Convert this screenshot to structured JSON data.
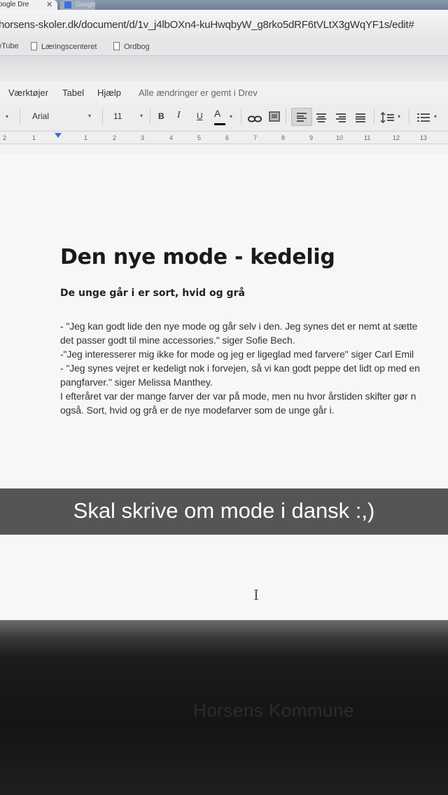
{
  "browser": {
    "active_tab_title": "oogle Dre",
    "close_glyph": "✕",
    "second_tab_title": "Google",
    "url": "horsens-skoler.dk/document/d/1v_j4lbOXn4-kuHwqbyW_g8rko5dRF6tVLtX3gWqYF1s/edit#",
    "bookmarks": [
      {
        "label": "eTube"
      },
      {
        "label": "Læringscenteret",
        "icon": "page-icon"
      },
      {
        "label": "Ordbog",
        "icon": "page-icon"
      }
    ]
  },
  "menubar": {
    "items": [
      "Værktøjer",
      "Tabel",
      "Hjælp"
    ],
    "save_status": "Alle ændringer er gemt i Drev"
  },
  "toolbar": {
    "font_name": "Arial",
    "font_size": "11",
    "bold": "B",
    "italic": "I",
    "underline": "U",
    "text_color": "A",
    "dropdown_glyph": "▾",
    "text_color_value": "#000000"
  },
  "ruler": {
    "ticks": [
      "2",
      "1",
      "1",
      "2",
      "3",
      "4",
      "5",
      "6",
      "7",
      "8",
      "9",
      "10",
      "11",
      "12",
      "13"
    ]
  },
  "document": {
    "title": "Den nye mode - kedelig",
    "subtitle": "De unge går i er sort, hvid og grå",
    "lines": [
      "- \"Jeg kan godt lide den nye mode og går selv i den. Jeg synes det er nemt at sætte",
      "det passer godt til mine accessories.\" siger Sofie Bech.",
      "-\"Jeg interesserer mig ikke for mode og jeg er ligeglad med farvere\" siger Carl Emil",
      "- \"Jeg synes vejret er kedeligt nok i forvejen, så vi kan godt peppe det lidt op med en",
      "pangfarver.\" siger Melissa Manthey.",
      "I efteråret var der mange farver der var på mode, men nu hvor årstiden skifter gør n",
      "også. Sort, hvid og grå er de nye modefarver som de unge går i."
    ]
  },
  "caption": {
    "text": "Skal skrive om mode i dansk :,)"
  },
  "monitor": {
    "brand_label": "Horsens Kommune"
  }
}
